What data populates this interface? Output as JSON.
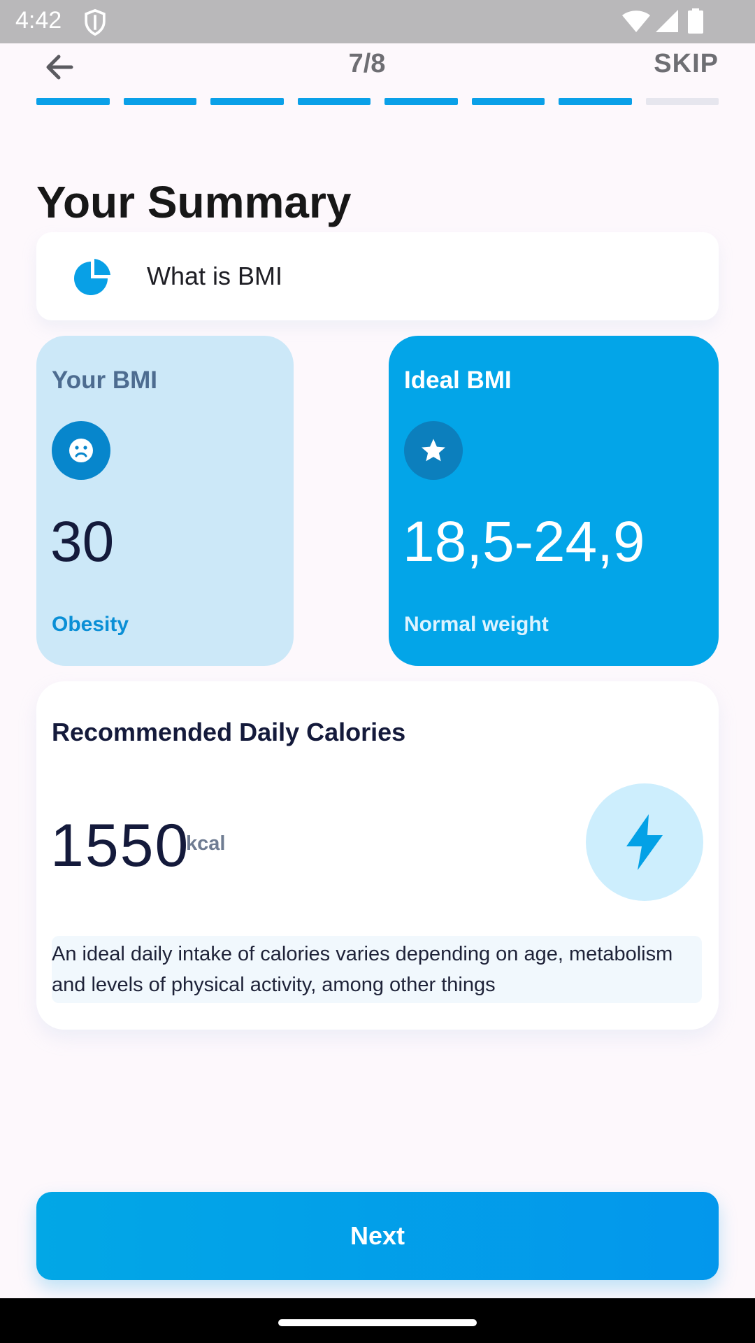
{
  "status_bar": {
    "time": "4:42",
    "icons": [
      "shield-icon",
      "wifi-icon",
      "cellular-icon",
      "battery-icon"
    ]
  },
  "header": {
    "back_icon": "arrow-left-icon",
    "step": "7/8",
    "skip_label": "SKIP",
    "progress": {
      "total_steps": 8,
      "completed_steps": 7
    }
  },
  "page": {
    "title": "Your Summary"
  },
  "bmi_info": {
    "icon": "pie-chart-icon",
    "label": "What is BMI"
  },
  "your_bmi": {
    "title": "Your BMI",
    "icon": "sad-face-icon",
    "value": "30",
    "status": "Obesity"
  },
  "ideal_bmi": {
    "title": "Ideal BMI",
    "icon": "star-icon",
    "value": "18,5-24,9",
    "status": "Normal weight"
  },
  "calories": {
    "title": "Recommended Daily Calories",
    "value": "1550",
    "unit": "kcal",
    "icon": "lightning-bolt-icon",
    "note": "An ideal daily intake of calories varies depending on age, metabolism and levels of physical activity, among other things"
  },
  "footer": {
    "next_label": "Next"
  },
  "colors": {
    "accent": "#03A5E8",
    "accent_dark": "#0786CC",
    "light_blue_card": "#CCE8F8",
    "progress_inactive": "#E6E6EE",
    "background": "#FDF8FC"
  }
}
